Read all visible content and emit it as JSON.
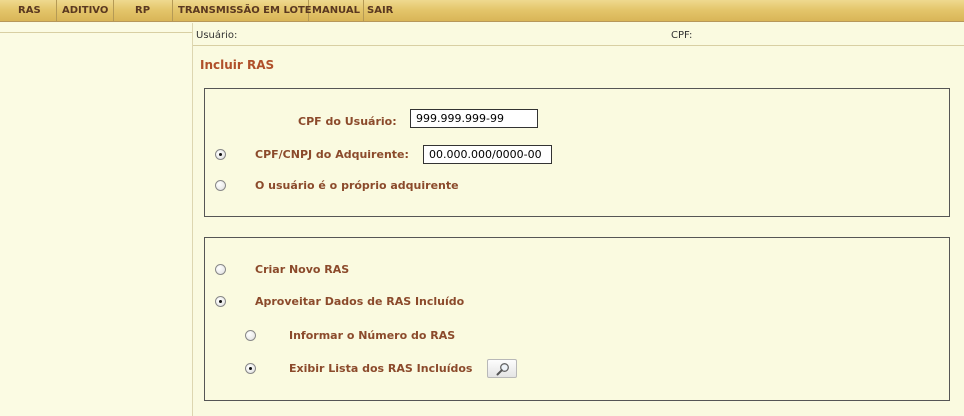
{
  "menu": {
    "items": [
      {
        "label": "RAS"
      },
      {
        "label": "ADITIVO"
      },
      {
        "label": "RP"
      },
      {
        "label": "TRANSMISSÃO EM LOTE"
      },
      {
        "label": "MANUAL"
      },
      {
        "label": "SAIR"
      }
    ]
  },
  "infobar": {
    "usuario_label": "Usuário:",
    "cpf_label": "CPF:"
  },
  "page": {
    "title": "Incluir RAS"
  },
  "form1": {
    "cpf_usuario_label": "CPF do Usuário:",
    "cpf_usuario_value": "999.999.999-99",
    "cpf_cnpj_adquirente_label": "CPF/CNPJ do Adquirente:",
    "cpf_cnpj_adquirente_value": "00.000.000/0000-00",
    "cpf_cnpj_adquirente_selected": true,
    "proprio_adquirente_label": "O usuário é o próprio adquirente",
    "proprio_adquirente_selected": false
  },
  "form2": {
    "criar_novo_label": "Criar Novo RAS",
    "criar_novo_selected": false,
    "aproveitar_label": "Aproveitar Dados de RAS Incluído",
    "aproveitar_selected": true,
    "informar_numero_label": "Informar o Número do RAS",
    "informar_numero_selected": false,
    "exibir_lista_label": "Exibir Lista dos RAS Incluídos",
    "exibir_lista_selected": true,
    "search_icon": "magnifier-icon"
  },
  "colors": {
    "menubar": "#e4c66c",
    "background": "#fafae0",
    "title": "#b0502a",
    "label": "#8b4a2b"
  }
}
